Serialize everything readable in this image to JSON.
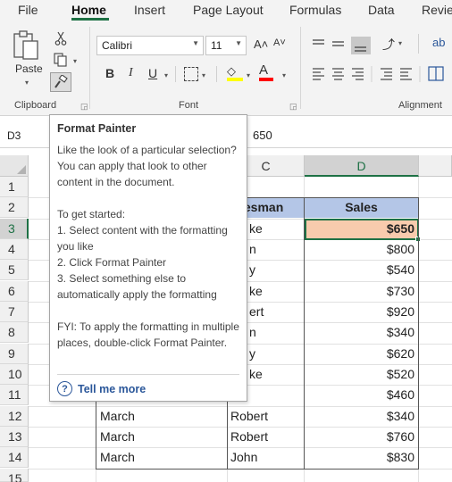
{
  "ribbon": {
    "tabs": [
      "File",
      "Home",
      "Insert",
      "Page Layout",
      "Formulas",
      "Data",
      "Revie"
    ],
    "clipboard": {
      "paste_label": "Paste",
      "group_label": "Clipboard"
    },
    "font": {
      "name": "Calibri",
      "size": "11",
      "grow": "A˄",
      "shrink": "A˅",
      "bold": "B",
      "italic": "I",
      "underline": "U",
      "group_label": "Font"
    },
    "alignment": {
      "group_label": "Alignment"
    }
  },
  "formula_bar": {
    "name_box": "D3",
    "value": "650"
  },
  "sheet": {
    "columns": [
      "C",
      "D"
    ],
    "rows": [
      "1",
      "2",
      "3",
      "4",
      "5",
      "6",
      "7",
      "8",
      "9",
      "10",
      "11",
      "12",
      "13",
      "14",
      "15"
    ],
    "header": {
      "salesman": "lesman",
      "sales": "Sales"
    },
    "data": [
      {
        "month": "",
        "salesman": "ke",
        "sales": "$650"
      },
      {
        "month": "",
        "salesman": "n",
        "sales": "$800"
      },
      {
        "month": "",
        "salesman": "y",
        "sales": "$540"
      },
      {
        "month": "",
        "salesman": "ke",
        "sales": "$730"
      },
      {
        "month": "",
        "salesman": "ert",
        "sales": "$920"
      },
      {
        "month": "",
        "salesman": "n",
        "sales": "$340"
      },
      {
        "month": "",
        "salesman": "y",
        "sales": "$620"
      },
      {
        "month": "",
        "salesman": "ke",
        "sales": "$520"
      },
      {
        "month": "",
        "salesman": "",
        "sales": "$460"
      },
      {
        "month": "March",
        "salesman": "Robert",
        "sales": "$340"
      },
      {
        "month": "March",
        "salesman": "Robert",
        "sales": "$760"
      },
      {
        "month": "March",
        "salesman": "John",
        "sales": "$830"
      }
    ]
  },
  "tooltip": {
    "title": "Format Painter",
    "intro": "Like the look of a particular selection? You can apply that look to other content in the document.",
    "started": "To get started:",
    "step1": "1. Select content with the formatting you like",
    "step2": "2. Click Format Painter",
    "step3": "3. Select something else to automatically apply the formatting",
    "fyi": "FYI: To apply the formatting in multiple places, double-click Format Painter.",
    "more": "Tell me more"
  },
  "colors": {
    "accent": "#1e7145",
    "header_fill": "#b4c6e7",
    "selected_fill": "#f8cbad",
    "link": "#2b579a"
  }
}
